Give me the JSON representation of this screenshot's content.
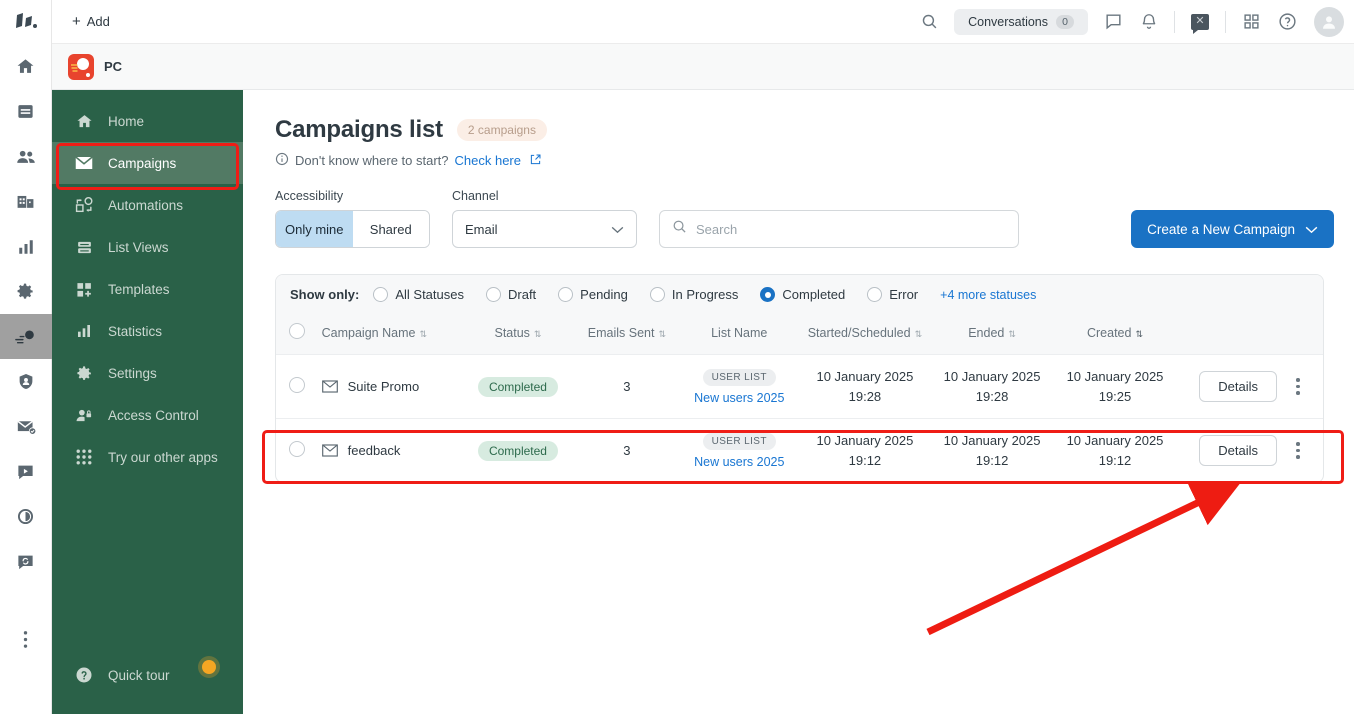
{
  "topbar": {
    "add_label": "Add",
    "search_icon": "search-icon",
    "conversations_label": "Conversations",
    "conversations_count": "0",
    "chat_icon": "chat-bubble-icon",
    "bell_icon": "bell-icon",
    "dark_chat_icon": "chat-dismiss-icon",
    "apps_icon": "apps-grid-icon",
    "help_icon": "help-circle-icon",
    "avatar_icon": "user-avatar"
  },
  "app_tab": {
    "name": "PC",
    "logo_icon": "pc-app-logo"
  },
  "rail": {
    "items": [
      {
        "icon": "home-icon",
        "active": false
      },
      {
        "icon": "inbox-icon",
        "active": false
      },
      {
        "icon": "contacts-icon",
        "active": false
      },
      {
        "icon": "company-icon",
        "active": false
      },
      {
        "icon": "analytics-bars-icon",
        "active": false
      },
      {
        "icon": "gear-icon",
        "active": false
      },
      {
        "icon": "campaign-comet-icon",
        "active": true
      },
      {
        "icon": "shield-user-icon",
        "active": false
      },
      {
        "icon": "mail-check-icon",
        "active": false
      },
      {
        "icon": "video-chat-icon",
        "active": false
      },
      {
        "icon": "pie-chat-icon",
        "active": false
      },
      {
        "icon": "chat-refresh-icon",
        "active": false
      },
      {
        "icon": "more-vertical-icon",
        "active": false
      }
    ]
  },
  "sidebar": {
    "items": [
      {
        "label": "Home",
        "icon": "home-icon",
        "selected": false
      },
      {
        "label": "Campaigns",
        "icon": "envelope-icon",
        "selected": true
      },
      {
        "label": "Automations",
        "icon": "automations-icon",
        "selected": false
      },
      {
        "label": "List Views",
        "icon": "list-views-icon",
        "selected": false
      },
      {
        "label": "Templates",
        "icon": "templates-icon",
        "selected": false
      },
      {
        "label": "Statistics",
        "icon": "bar-chart-icon",
        "selected": false
      },
      {
        "label": "Settings",
        "icon": "gear-icon",
        "selected": false
      },
      {
        "label": "Access Control",
        "icon": "user-lock-icon",
        "selected": false
      },
      {
        "label": "Try our other apps",
        "icon": "grid-dots-icon",
        "selected": false
      }
    ],
    "quick_tour": {
      "label": "Quick tour",
      "icon": "question-circle-icon"
    }
  },
  "page": {
    "title": "Campaigns list",
    "count_badge": "2 campaigns",
    "hint_prefix": "Don't know where to start?",
    "hint_link": "Check here",
    "info_icon": "info-circle-icon",
    "external_icon": "external-link-icon"
  },
  "filters": {
    "accessibility_label": "Accessibility",
    "accessibility_options": [
      "Only mine",
      "Shared"
    ],
    "accessibility_selected": "Only mine",
    "channel_label": "Channel",
    "channel_value": "Email",
    "search_placeholder": "Search",
    "search_value": "",
    "create_button": "Create a New Campaign"
  },
  "show_only": {
    "lead": "Show only:",
    "options": [
      {
        "label": "All Statuses",
        "selected": false
      },
      {
        "label": "Draft",
        "selected": false
      },
      {
        "label": "Pending",
        "selected": false
      },
      {
        "label": "In Progress",
        "selected": false
      },
      {
        "label": "Completed",
        "selected": true
      },
      {
        "label": "Error",
        "selected": false
      }
    ],
    "more_link": "+4 more statuses"
  },
  "table": {
    "columns": [
      {
        "label": "Campaign Name",
        "sortable": true
      },
      {
        "label": "Status",
        "sortable": true
      },
      {
        "label": "Emails Sent",
        "sortable": true
      },
      {
        "label": "List Name",
        "sortable": false
      },
      {
        "label": "Started/Scheduled",
        "sortable": true
      },
      {
        "label": "Ended",
        "sortable": true
      },
      {
        "label": "Created",
        "sortable": true
      }
    ],
    "rows": [
      {
        "name": "Suite Promo",
        "status": "Completed",
        "emails_sent": "3",
        "list_chip": "USER LIST",
        "list_name": "New users 2025",
        "started_date": "10 January 2025",
        "started_time": "19:28",
        "ended_date": "10 January 2025",
        "ended_time": "19:28",
        "created_date": "10 January 2025",
        "created_time": "19:25",
        "details_label": "Details"
      },
      {
        "name": "feedback",
        "status": "Completed",
        "emails_sent": "3",
        "list_chip": "USER LIST",
        "list_name": "New users 2025",
        "started_date": "10 January 2025",
        "started_time": "19:12",
        "ended_date": "10 January 2025",
        "ended_time": "19:12",
        "created_date": "10 January 2025",
        "created_time": "19:12",
        "details_label": "Details"
      }
    ]
  },
  "colors": {
    "sidebar_green": "#2a6148",
    "sidebar_selected": "#527a64",
    "accent_blue": "#1a72c4",
    "annotation_red": "#ef1d16",
    "status_badge_bg": "#d7ebe0",
    "status_badge_text": "#2d6a4c",
    "count_badge_bg": "#fbeee6",
    "app_logo_red": "#e8442e"
  }
}
